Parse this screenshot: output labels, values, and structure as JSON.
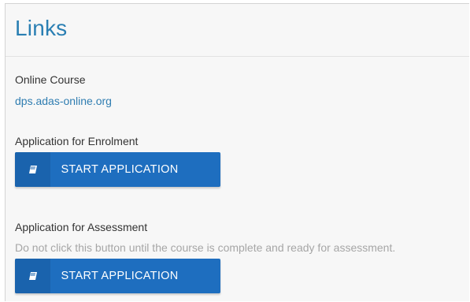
{
  "heading": "Links",
  "sections": [
    {
      "label": "Online Course",
      "link": "dps.adas-online.org"
    },
    {
      "label": "Application for Enrolment",
      "button_label": "START APPLICATION"
    },
    {
      "label": "Application for Assessment",
      "note": "Do not click this button until the course is complete and ready for assessment.",
      "button_label": "START APPLICATION"
    }
  ],
  "colors": {
    "heading": "#2a7fb3",
    "link": "#2f7db1",
    "button": "#1e6ebf"
  },
  "icons": {
    "button_icon": "book-icon"
  }
}
